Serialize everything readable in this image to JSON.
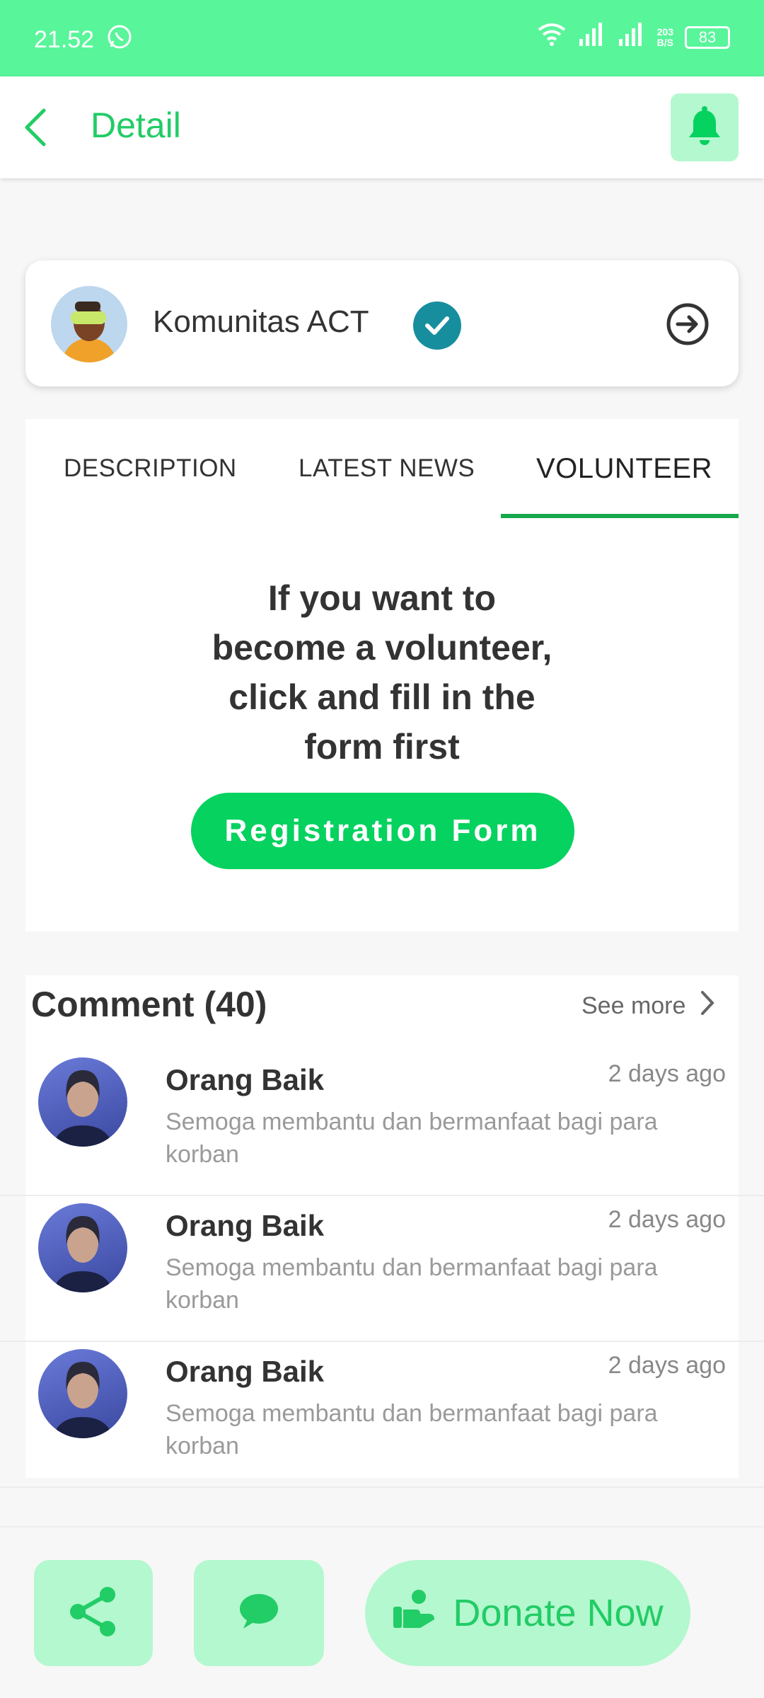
{
  "status_bar": {
    "time": "21.52",
    "speed_top": "203",
    "speed_bottom": "B/S",
    "battery": "83"
  },
  "header": {
    "title": "Detail"
  },
  "organization": {
    "name": "Komunitas ACT"
  },
  "tabs": [
    {
      "label": "DESCRIPTION"
    },
    {
      "label": "LATEST NEWS"
    },
    {
      "label": "VOLUNTEER"
    }
  ],
  "volunteer": {
    "lines": [
      "If you want to",
      "become a volunteer,",
      "click and fill in the",
      "form first"
    ],
    "button": "Registration Form"
  },
  "comments": {
    "title": "Comment (40)",
    "see_more": "See more",
    "items": [
      {
        "name": "Orang Baik",
        "time": "2 days ago",
        "text": "Semoga membantu dan bermanfaat bagi para korban"
      },
      {
        "name": "Orang Baik",
        "time": "2 days ago",
        "text": "Semoga membantu dan bermanfaat bagi para korban"
      },
      {
        "name": "Orang Baik",
        "time": "2 days ago",
        "text": "Semoga membantu dan bermanfaat bagi para korban"
      }
    ]
  },
  "bottom": {
    "donate": "Donate Now"
  },
  "colors": {
    "status_bar": "#58f59a",
    "primary": "#22cc66",
    "button": "#05d25f",
    "light_green": "#b4f8cf",
    "verified": "#178e9e"
  }
}
